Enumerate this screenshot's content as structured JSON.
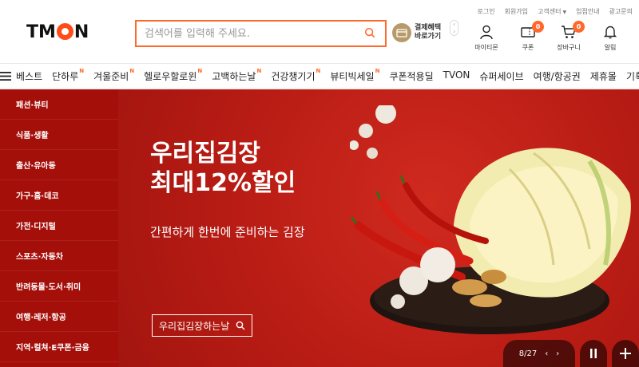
{
  "util_links": [
    "로그인",
    "회원가입",
    "고객센터",
    "입점안내",
    "광고문의"
  ],
  "logo": {
    "pre": "TM",
    "post": "N"
  },
  "search": {
    "placeholder": "검색어를 입력해 주세요."
  },
  "pay": {
    "line1": "결제혜택",
    "line2": "바로가기"
  },
  "header_icons": {
    "my": "마이티몬",
    "coupon": "쿠폰",
    "coupon_count": "0",
    "cart": "장바구니",
    "cart_count": "0",
    "alarm": "알림"
  },
  "nav": [
    {
      "label": "베스트",
      "new": ""
    },
    {
      "label": "단하루",
      "new": "N"
    },
    {
      "label": "겨울준비",
      "new": "N"
    },
    {
      "label": "헬로우할로윈",
      "new": "N"
    },
    {
      "label": "고백하는날",
      "new": "N"
    },
    {
      "label": "건강챙기기",
      "new": "N"
    },
    {
      "label": "뷰티빅세일",
      "new": "N"
    },
    {
      "label": "쿠폰적용딜",
      "new": ""
    },
    {
      "label": "TVON",
      "new": ""
    },
    {
      "label": "슈퍼세이브",
      "new": ""
    },
    {
      "label": "여행/항공권",
      "new": ""
    },
    {
      "label": "제휴몰",
      "new": ""
    },
    {
      "label": "기획전",
      "new": ""
    }
  ],
  "categories": [
    "패션·뷰티",
    "식품·생활",
    "출산·유아동",
    "가구·홈·데코",
    "가전·디지털",
    "스포츠·자동차",
    "반려동물·도서·취미",
    "여행·레저·항공",
    "지역·컬쳐·E쿠폰·금융"
  ],
  "banner": {
    "title": "우리집김장\n최대12%할인",
    "subtitle": "간편하게 한번에 준비하는 김장",
    "cta": "우리집김장하는날",
    "page": "8/27"
  },
  "colors": {
    "brand": "#ff6a2c",
    "banner_bg": "#b81c14",
    "side_bg": "#a50f0a"
  }
}
